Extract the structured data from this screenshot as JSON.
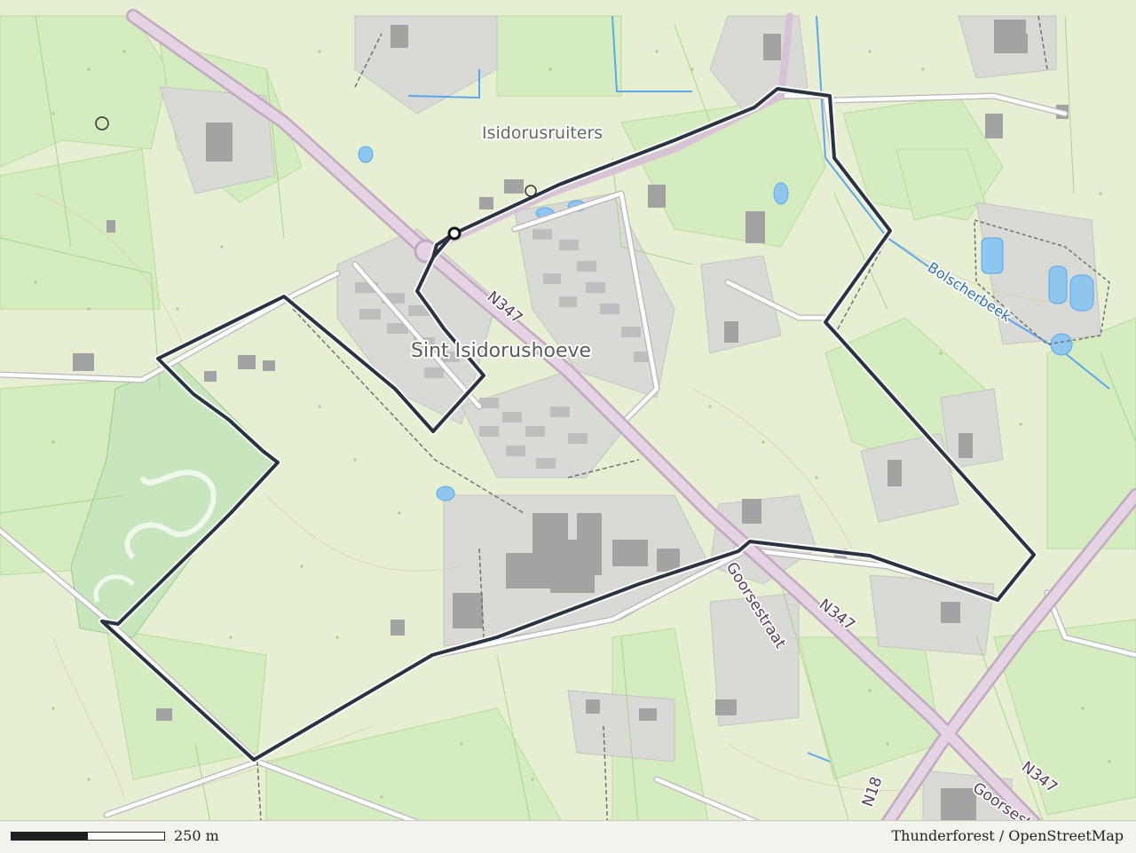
{
  "map": {
    "places": {
      "town": "Sint Isidorushoeve",
      "poi": "Isidorusruiters"
    },
    "roads": {
      "n347_north": "N347",
      "n347_mid": "N347",
      "n347_south": "N347",
      "goorsestraat_north": "Goorsestraat",
      "goorsestraat_south": "Goorsestra",
      "n18": "N18"
    },
    "waterways": {
      "bolscherbeek": "Bolscherbeek"
    },
    "colors": {
      "land": "#e6efd2",
      "meadow": "#d5ecc1",
      "built_up": "#d9d9d6",
      "building": "#a0a0a0",
      "road_casing": "#c8b0c6",
      "road_fill": "#e4d3e2",
      "water": "#5ba7ea",
      "route": "#2a3440"
    }
  },
  "footer": {
    "scale_label": "250 m",
    "attribution": "Thunderforest / OpenStreetMap"
  }
}
